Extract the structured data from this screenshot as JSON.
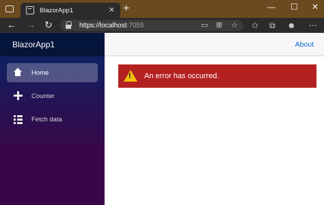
{
  "browser": {
    "tab_title": "BlazorApp1",
    "tab_close_glyph": "✕",
    "new_tab_glyph": "+",
    "url_host": "https://localhost",
    "url_port": ":7055",
    "window_controls": {
      "minimize": "—",
      "maximize": "☐",
      "close": "✕"
    },
    "nav": {
      "back": "←",
      "forward": "→",
      "refresh": "↻"
    },
    "toolbar_icons": [
      "device-icon",
      "grid-icon",
      "star-add-icon",
      "favorites-icon",
      "collections-icon",
      "profile-icon",
      "more-icon"
    ]
  },
  "app": {
    "brand": "BlazorApp1",
    "nav_items": [
      {
        "label": "Home",
        "icon": "home-icon",
        "active": true
      },
      {
        "label": "Counter",
        "icon": "plus-icon",
        "active": false
      },
      {
        "label": "Fetch data",
        "icon": "list-icon",
        "active": false
      }
    ],
    "about_link": "About",
    "error_message": "An error has occurred."
  },
  "colors": {
    "sidebar_top": "#052767",
    "sidebar_bottom": "#3a0647",
    "error_bg": "#b32121",
    "link": "#0366d6",
    "warning": "#f2c20e"
  }
}
